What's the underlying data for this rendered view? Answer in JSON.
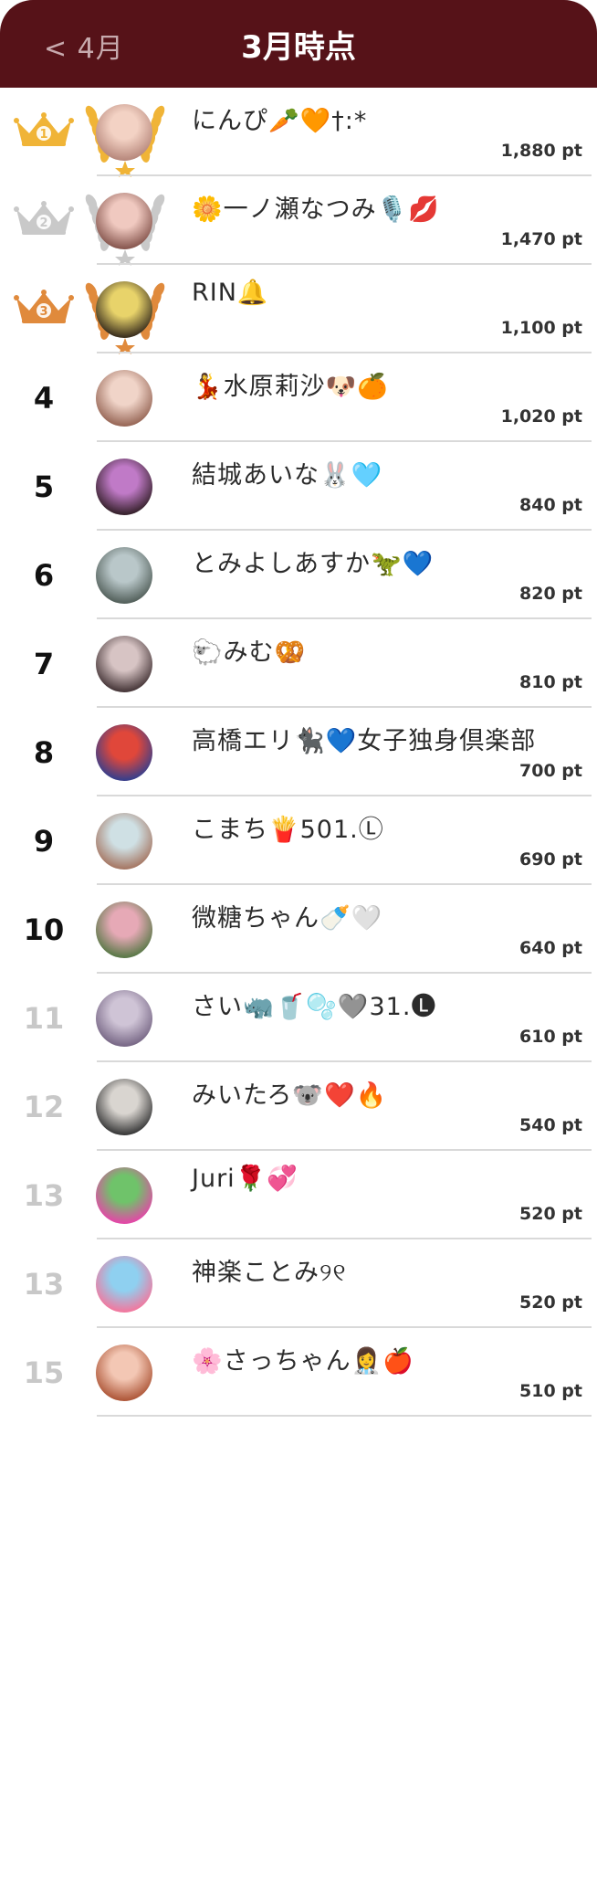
{
  "header": {
    "back_label": "< 4月",
    "title": "3月時点"
  },
  "colors": {
    "header_bg": "#561218",
    "gold": "#f0b437",
    "silver": "#c9c9c9",
    "bronze": "#e08a3c"
  },
  "ranking": [
    {
      "rank": "1",
      "medal": "gold",
      "name": "にんぴ🥕🧡†:*",
      "points": "1,880 pt",
      "avatar": [
        "#f3d2c4",
        "#b98a7e"
      ]
    },
    {
      "rank": "2",
      "medal": "silver",
      "name": "🌼一ノ瀬なつみ🎙️💋",
      "points": "1,470 pt",
      "avatar": [
        "#f0c9c0",
        "#8a5a52"
      ]
    },
    {
      "rank": "3",
      "medal": "bronze",
      "name": "RIN🔔",
      "points": "1,100 pt",
      "avatar": [
        "#e8d36a",
        "#3f3320"
      ]
    },
    {
      "rank": "4",
      "medal": "",
      "name": "💃水原莉沙🐶🍊",
      "points": "1,020 pt",
      "avatar": [
        "#f0d4c8",
        "#9a6a5a"
      ]
    },
    {
      "rank": "5",
      "medal": "",
      "name": "結城あいな🐰🩵",
      "points": "840 pt",
      "avatar": [
        "#c07ac7",
        "#3a2430"
      ]
    },
    {
      "rank": "6",
      "medal": "",
      "name": "とみよしあすか🦖💙",
      "points": "820 pt",
      "avatar": [
        "#b9c7c9",
        "#56635e"
      ]
    },
    {
      "rank": "7",
      "medal": "",
      "name": "🐑みむ🥨",
      "points": "810 pt",
      "avatar": [
        "#d7c4c4",
        "#4a3a3c"
      ]
    },
    {
      "rank": "8",
      "medal": "",
      "name": "高橋エリ🐈‍⬛💙女子独身倶楽部",
      "points": "700 pt",
      "avatar": [
        "#e0473a",
        "#3b3f8a"
      ]
    },
    {
      "rank": "9",
      "medal": "",
      "name": "こまち🍟501.Ⓛ",
      "points": "690 pt",
      "avatar": [
        "#cfe0e4",
        "#a77a67"
      ]
    },
    {
      "rank": "10",
      "medal": "",
      "name": "微糖ちゃん🍼🤍",
      "points": "640 pt",
      "avatar": [
        "#e6a9b6",
        "#5d7a4a"
      ]
    },
    {
      "rank": "11",
      "medal": "",
      "name": "さい🦏🥤🫧🩶31.🅛",
      "points": "610 pt",
      "avatar": [
        "#cfc4d6",
        "#7a6a88"
      ]
    },
    {
      "rank": "12",
      "medal": "",
      "name": "みいたろ🐨❤️🔥",
      "points": "540 pt",
      "avatar": [
        "#d9d5d0",
        "#3d3d3d"
      ]
    },
    {
      "rank": "13",
      "medal": "",
      "name": "Juri🌹💞",
      "points": "520 pt",
      "avatar": [
        "#6fc36a",
        "#e14aa6"
      ]
    },
    {
      "rank": "13",
      "medal": "",
      "name": "神楽ことみ୨୧",
      "points": "520 pt",
      "avatar": [
        "#8fd0f0",
        "#f07aa0"
      ]
    },
    {
      "rank": "15",
      "medal": "",
      "name": "🌸さっちゃん👩‍⚕️🍎",
      "points": "510 pt",
      "avatar": [
        "#f3c7b4",
        "#b05a3c"
      ]
    }
  ]
}
